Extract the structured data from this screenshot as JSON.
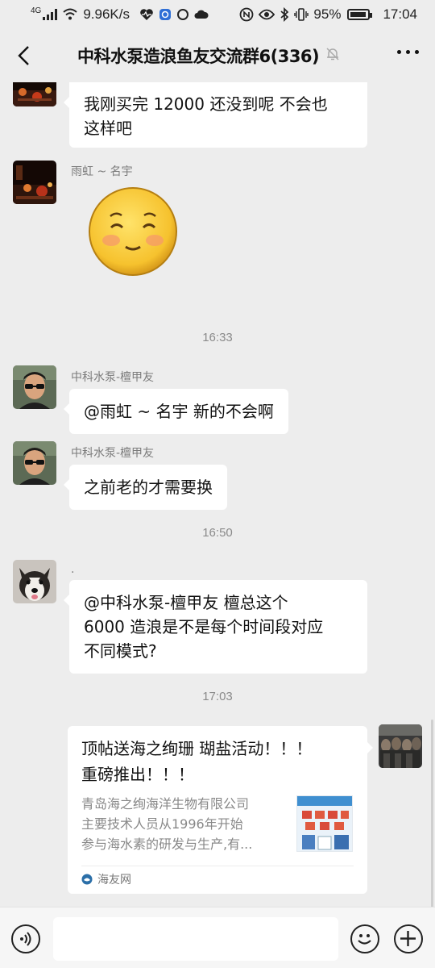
{
  "status_bar": {
    "network_type": "4G",
    "net_speed": "9.96K/s",
    "battery": "95%",
    "time": "17:04"
  },
  "header": {
    "title": "中科水泵造浪鱼友交流群6(336)"
  },
  "messages": [
    {
      "text": "我刚买完 12000 还没到呢  不会也\n这样吧"
    },
    {
      "sender": "雨虹 ~ 名宇",
      "sticker": "shy-face-emoji"
    },
    {
      "time": "16:33"
    },
    {
      "sender": "中科水泵-檀甲友",
      "text": "@雨虹 ~ 名宇  新的不会啊"
    },
    {
      "sender": "中科水泵-檀甲友",
      "text": "之前老的才需要换"
    },
    {
      "time": "16:50"
    },
    {
      "sender": ".",
      "text": "@中科水泵-檀甲友  檀总这个\n6000 造浪是不是每个时间段对应\n不同模式?"
    },
    {
      "time": "17:03"
    }
  ],
  "card": {
    "title": "顶帖送海之绚珊 瑚盐活动！！！\n重磅推出！！！",
    "desc_lines": [
      "青岛海之绚海洋生物有限公司",
      "主要技术人员从1996年开始",
      "参与海水素的研发与生产,有..."
    ],
    "source": "海友网"
  },
  "colors": {
    "background": "#ededed",
    "bubble": "#ffffff",
    "meta_text": "#8a8a8a"
  }
}
